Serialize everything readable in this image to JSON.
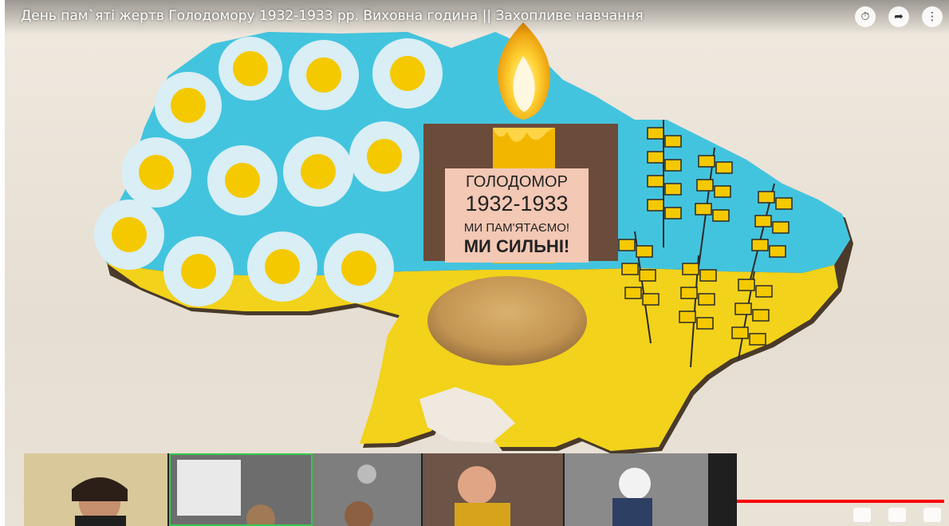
{
  "video": {
    "title": "День пам`яті жертв Голодомору 1932-1933 рр. Виховна година || Захопливе навчання"
  },
  "poster": {
    "line1": "ГОЛОДОМОР",
    "line2": "1932-1933",
    "line3": "МИ ПАМ'ЯТАЄМО!",
    "line4": "МИ СИЛЬНІ!"
  },
  "icons": {
    "clock": "clock-icon",
    "share": "share-icon",
    "more": "more-icon",
    "settings": "gear-icon",
    "fullscreen": "fullscreen-icon"
  },
  "colors": {
    "blue": "#43c4de",
    "yellow": "#f2d21a",
    "flame": "#f6b400",
    "brown": "#6b4b3a",
    "progress": "#ff0000",
    "active_tile": "#37c84f"
  },
  "participants": [
    {
      "name": "participant-1"
    },
    {
      "name": "participant-2"
    },
    {
      "name": "participant-3"
    },
    {
      "name": "participant-4"
    },
    {
      "name": "participant-5"
    }
  ]
}
